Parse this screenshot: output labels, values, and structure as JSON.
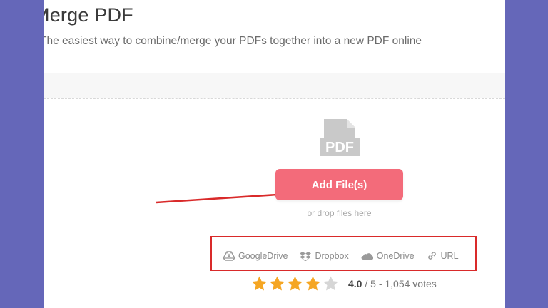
{
  "header": {
    "title": "Merge PDF",
    "subtitle": "The easiest way to combine/merge your PDFs together into a new PDF online"
  },
  "upload": {
    "pdf_icon_label": "PDF",
    "add_files_label": "Add File(s)",
    "drop_hint": "or drop files here",
    "sources": [
      {
        "label": "GoogleDrive",
        "icon": "google-drive-icon"
      },
      {
        "label": "Dropbox",
        "icon": "dropbox-icon"
      },
      {
        "label": "OneDrive",
        "icon": "onedrive-icon"
      },
      {
        "label": "URL",
        "icon": "link-icon"
      }
    ]
  },
  "rating": {
    "score": "4.0",
    "rest": " / 5 - 1,054 votes",
    "stars_filled": 4,
    "stars_total": 5
  },
  "colors": {
    "background": "#6567b9",
    "accent": "#f36b7a",
    "annotation": "#d92a2a",
    "star": "#f5a623"
  }
}
